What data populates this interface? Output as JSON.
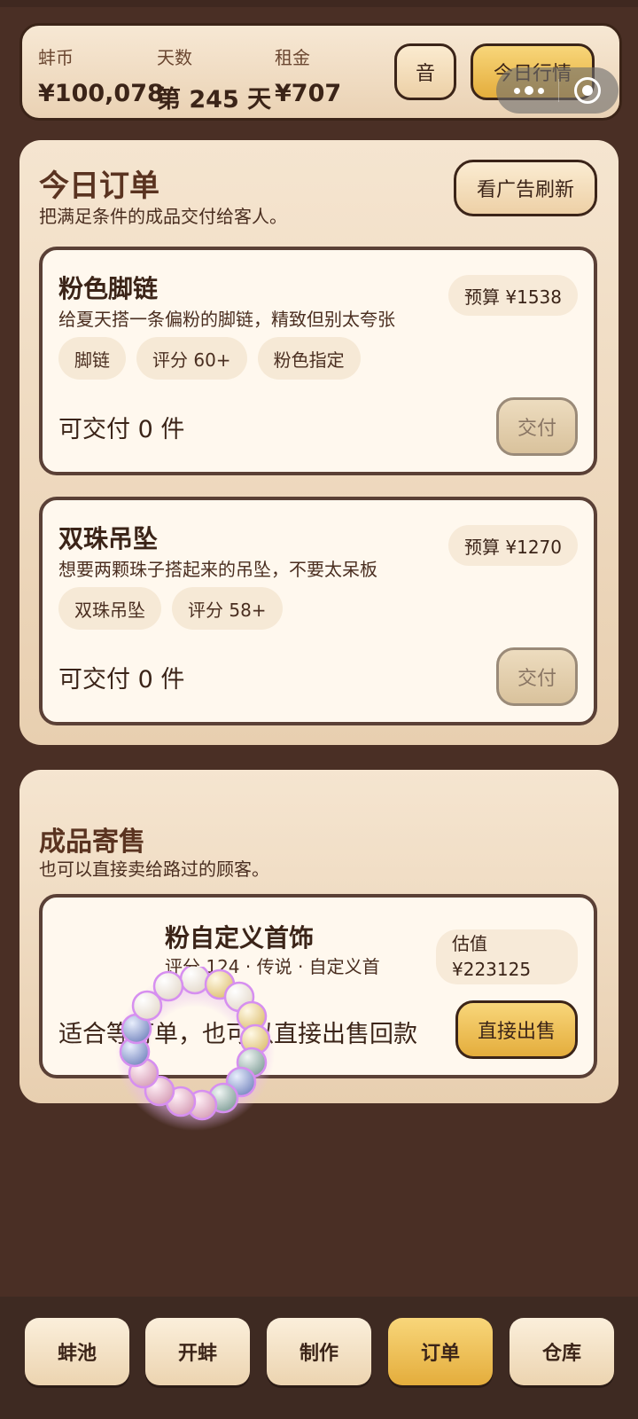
{
  "stats": {
    "coins": {
      "label": "蚌币",
      "value": "¥100,078"
    },
    "days": {
      "label": "天数",
      "value": "第 245 天"
    },
    "rent": {
      "label": "租金",
      "value": "¥707"
    }
  },
  "buttons": {
    "sound": "音",
    "market": "今日行情"
  },
  "orders": {
    "title": "今日订单",
    "subtitle": "把满足条件的成品交付给客人。",
    "refresh_label": "看广告刷新",
    "items": [
      {
        "name": "粉色脚链",
        "desc": "给夏天搭一条偏粉的脚链，精致但别太夸张",
        "budget": "预算 ¥1538",
        "tags": [
          "脚链",
          "评分 60+",
          "粉色指定"
        ],
        "deliverable": "可交付 0 件",
        "deliver_label": "交付"
      },
      {
        "name": "双珠吊坠",
        "desc": "想要两颗珠子搭起来的吊坠，不要太呆板",
        "budget": "预算 ¥1270",
        "tags": [
          "双珠吊坠",
          "评分 58+"
        ],
        "deliverable": "可交付 0 件",
        "deliver_label": "交付"
      }
    ]
  },
  "consign": {
    "title": "成品寄售",
    "subtitle": "也可以直接卖给路过的顾客。",
    "item": {
      "name": "粉自定义首饰",
      "meta": "评分 124 · 传说 · 自定义首",
      "valuation_label": "估值",
      "valuation_value": "¥223125",
      "hint": "适合等订单，也可以直接出售回款",
      "sell_label": "直接出售"
    }
  },
  "nav": {
    "items": [
      "蚌池",
      "开蚌",
      "制作",
      "订单",
      "仓库"
    ],
    "active": "订单"
  },
  "colors": {
    "accent": "#e4ad3c",
    "background": "#4a2f25",
    "panel": "#f5e5d0"
  }
}
